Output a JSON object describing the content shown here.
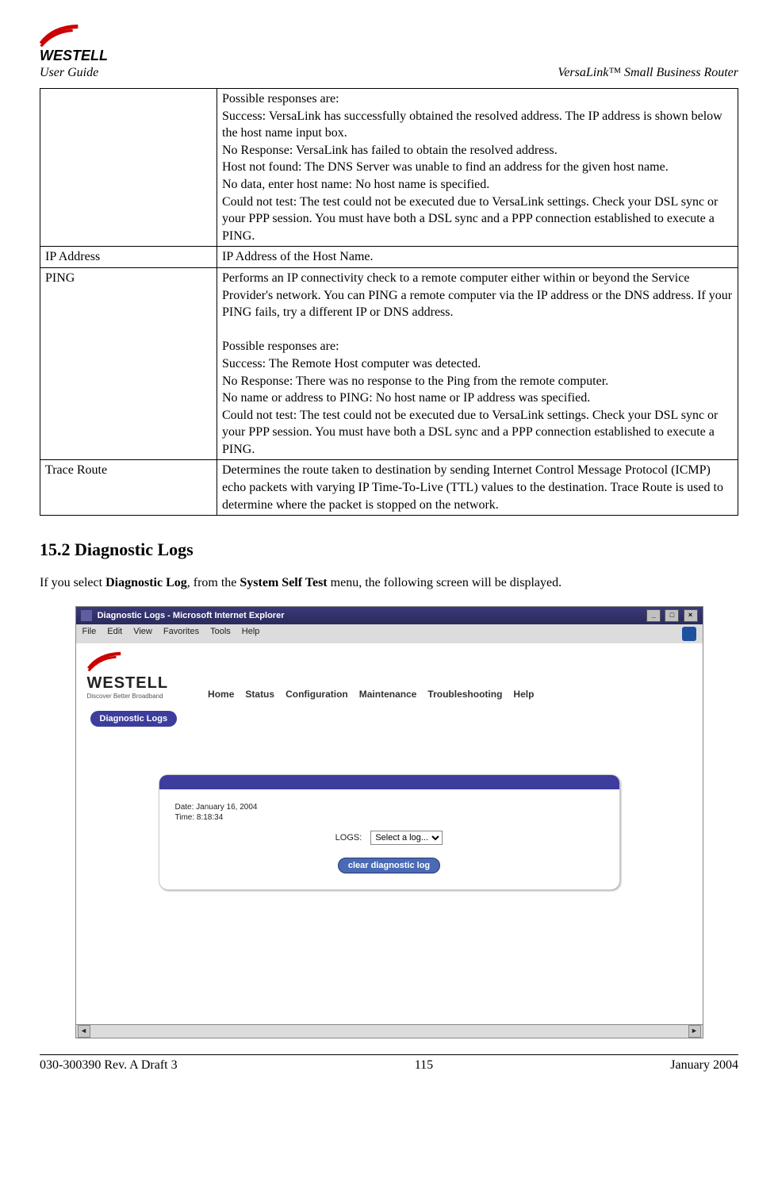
{
  "header": {
    "brand": "WESTELL",
    "left_label": "User Guide",
    "right_label": "VersaLink™  Small Business Router"
  },
  "table": {
    "rows": [
      {
        "label": "",
        "desc": "Possible responses are:\nSuccess: VersaLink has successfully obtained the resolved address. The IP address is shown below the host name input box.\nNo Response: VersaLink has failed to obtain the resolved address.\nHost not found: The DNS Server was unable to find an address for the given host name.\nNo data, enter host name: No host name is specified.\nCould not test: The test could not be executed due to VersaLink settings. Check your DSL sync or your PPP session. You must have both a DSL sync and a PPP connection established to execute a PING."
      },
      {
        "label": "IP Address",
        "desc": "IP Address of the Host Name."
      },
      {
        "label": "PING",
        "desc": "Performs an IP connectivity check to a remote computer either within or beyond the Service Provider's network.  You can PING a remote computer via the IP address or the DNS address. If your PING fails, try a different IP or DNS address.\n\nPossible responses are:\nSuccess: The Remote Host computer was detected.\nNo Response: There was no response to the Ping from the remote computer.\nNo name or address to PING: No host name or IP address was specified.\nCould not test: The test could not be executed due to VersaLink settings. Check your DSL sync or your PPP session. You must have both a DSL sync and a PPP connection established to execute a PING."
      },
      {
        "label": "Trace Route",
        "desc": "Determines the route taken to destination by sending Internet Control Message Protocol (ICMP) echo packets with varying IP Time-To-Live (TTL) values to the destination. Trace Route is used to determine where the packet is stopped on the network."
      }
    ]
  },
  "section": {
    "heading": "15.2 Diagnostic Logs",
    "intro_prefix": "If you select ",
    "intro_bold1": "Diagnostic Log",
    "intro_mid": ", from the ",
    "intro_bold2": "System Self Test",
    "intro_suffix": " menu, the following screen will be displayed."
  },
  "screenshot": {
    "title": "Diagnostic Logs - Microsoft Internet Explorer",
    "menus": [
      "File",
      "Edit",
      "View",
      "Favorites",
      "Tools",
      "Help"
    ],
    "brand": "WESTELL",
    "tagline": "Discover Better Broadband",
    "nav": [
      "Home",
      "Status",
      "Configuration",
      "Maintenance",
      "Troubleshooting",
      "Help"
    ],
    "tab": "Diagnostic Logs",
    "date_label": "Date: January 16, 2004",
    "time_label": "Time: 8:18:34",
    "logs_label": "LOGS:",
    "logs_select": "Select a log...",
    "clear_button": "clear diagnostic log"
  },
  "footer": {
    "left": "030-300390 Rev. A Draft 3",
    "center": "115",
    "right": "January 2004"
  }
}
